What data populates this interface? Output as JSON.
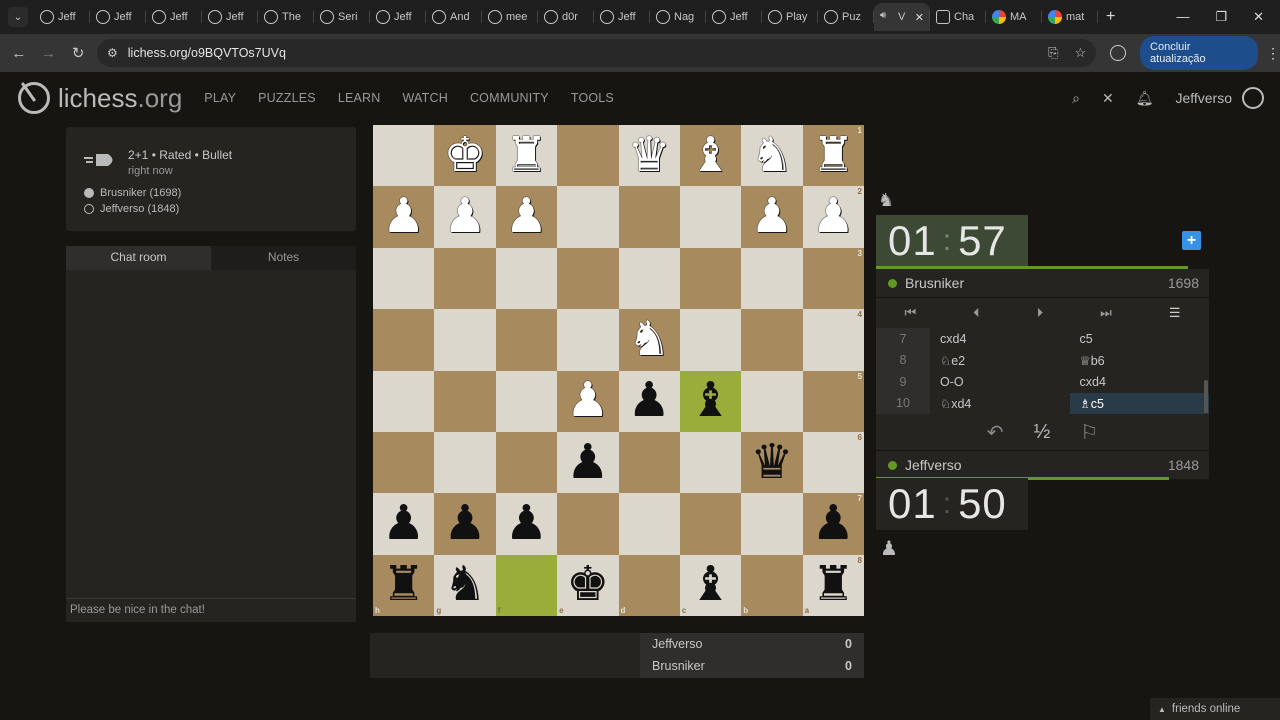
{
  "browser": {
    "tabs": [
      {
        "label": "Jeff",
        "icon": "lichess-icon"
      },
      {
        "label": "Jeff",
        "icon": "lichess-icon"
      },
      {
        "label": "Jeff",
        "icon": "lichess-icon"
      },
      {
        "label": "Jeff",
        "icon": "lichess-icon"
      },
      {
        "label": "The",
        "icon": "lichess-icon"
      },
      {
        "label": "Seri",
        "icon": "lichess-icon"
      },
      {
        "label": "Jeff",
        "icon": "lichess-icon"
      },
      {
        "label": "And",
        "icon": "lichess-icon"
      },
      {
        "label": "mee",
        "icon": "lichess-icon"
      },
      {
        "label": "d0r",
        "icon": "lichess-icon"
      },
      {
        "label": "Jeff",
        "icon": "lichess-icon"
      },
      {
        "label": "Nag",
        "icon": "lichess-icon"
      },
      {
        "label": "Jeff",
        "icon": "lichess-icon"
      },
      {
        "label": "Play",
        "icon": "lichess-icon"
      },
      {
        "label": "Puz",
        "icon": "lichess-icon"
      }
    ],
    "active_tab": {
      "label": "V",
      "icon": "speaker-icon"
    },
    "extra_tabs": [
      {
        "label": "Cha",
        "icon": "chatgpt-icon"
      },
      {
        "label": "MA",
        "icon": "google-icon"
      },
      {
        "label": "mat",
        "icon": "google-icon"
      }
    ],
    "url": "lichess.org/o9BQVTOs7UVq",
    "update_button": "Concluir atualização"
  },
  "site": {
    "logo": "lichess",
    "logo_suffix": ".org",
    "nav": [
      "PLAY",
      "PUZZLES",
      "LEARN",
      "WATCH",
      "COMMUNITY",
      "TOOLS"
    ],
    "username": "Jeffverso"
  },
  "game_info": {
    "title": "2+1 • Rated • Bullet",
    "time": "right now",
    "white_player": "Brusniker (1698)",
    "black_player": "Jeffverso (1848)"
  },
  "chat": {
    "tab_chat": "Chat room",
    "tab_notes": "Notes",
    "placeholder": "Please be nice in the chat!"
  },
  "board": {
    "orientation": "black",
    "ranks": [
      "1",
      "2",
      "3",
      "4",
      "5",
      "6",
      "7",
      "8"
    ],
    "files": [
      "h",
      "g",
      "f",
      "e",
      "d",
      "c",
      "b",
      "a"
    ],
    "rows": [
      [
        "",
        "wK",
        "wR",
        "",
        "wQ",
        "wB",
        "wN",
        "wR"
      ],
      [
        "wP",
        "wP",
        "wP",
        "",
        "",
        "",
        "wP",
        "wP"
      ],
      [
        "",
        "",
        "",
        "",
        "",
        "",
        "",
        ""
      ],
      [
        "",
        "",
        "",
        "",
        "wN",
        "",
        "",
        ""
      ],
      [
        "",
        "",
        "",
        "wP",
        "bP",
        "bB",
        "",
        ""
      ],
      [
        "",
        "",
        "",
        "bP",
        "",
        "",
        "bQ",
        ""
      ],
      [
        "bP",
        "bP",
        "bP",
        "",
        "",
        "",
        "",
        "bP"
      ],
      [
        "bR",
        "bN",
        "",
        "bK",
        "",
        "bB",
        "",
        "bR"
      ]
    ],
    "highlights": [
      "4-5",
      "7-2"
    ]
  },
  "opponent": {
    "name": "Brusniker",
    "rating": "1698",
    "clock_min": "01",
    "clock_sec": "57"
  },
  "me": {
    "name": "Jeffverso",
    "rating": "1848",
    "clock_min": "01",
    "clock_sec": "50"
  },
  "moves": [
    {
      "n": "7",
      "w": "cxd4",
      "b": "c5"
    },
    {
      "n": "8",
      "w": "♘e2",
      "b": "♕b6"
    },
    {
      "n": "9",
      "w": "O-O",
      "b": "cxd4"
    },
    {
      "n": "10",
      "w": "♘xd4",
      "b": "♗c5"
    }
  ],
  "actions": {
    "draw": "½"
  },
  "score": [
    {
      "name": "Jeffverso",
      "points": "0"
    },
    {
      "name": "Brusniker",
      "points": "0"
    }
  ],
  "friends": "friends online"
}
